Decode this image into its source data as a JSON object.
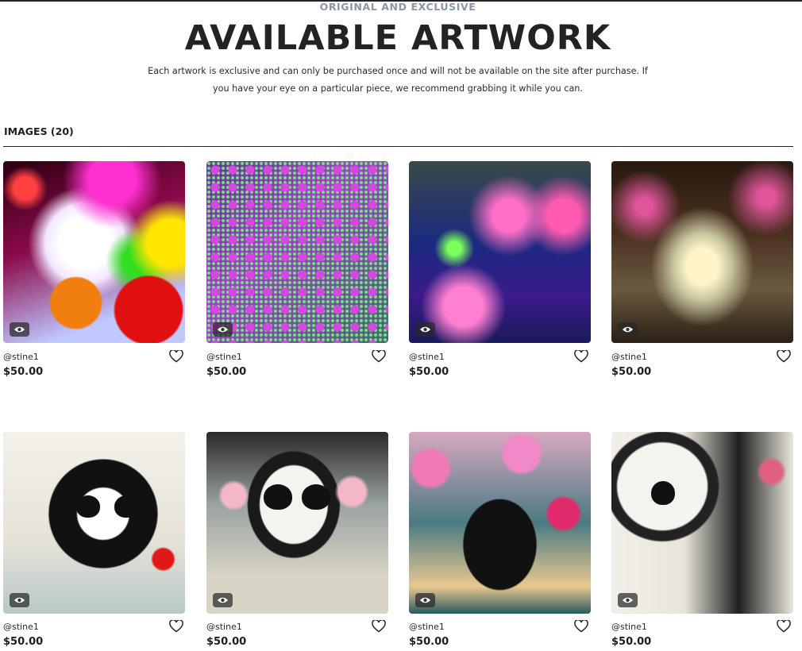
{
  "header": {
    "eyebrow": "ORIGINAL AND EXCLUSIVE",
    "title": "AVAILABLE ARTWORK",
    "description": "Each artwork is exclusive and can only be purchased once and will not be available on the site after purchase. If you have your eye on a particular piece, we recommend grabbing it while you can."
  },
  "gallery": {
    "section_label": "IMAGES (20)",
    "items": [
      {
        "user": "@stine1",
        "price": "$50.00",
        "art": "neon-abstract-light"
      },
      {
        "user": "@stine1",
        "price": "$50.00",
        "art": "purple-dot-pattern"
      },
      {
        "user": "@stine1",
        "price": "$50.00",
        "art": "psychedelic-room"
      },
      {
        "user": "@stine1",
        "price": "$50.00",
        "art": "flower-garden-archway"
      },
      {
        "user": "@stine1",
        "price": "$50.00",
        "art": "skull-with-flowers-1"
      },
      {
        "user": "@stine1",
        "price": "$50.00",
        "art": "skull-with-flowers-2"
      },
      {
        "user": "@stine1",
        "price": "$50.00",
        "art": "skull-with-flowers-3"
      },
      {
        "user": "@stine1",
        "price": "$50.00",
        "art": "skull-with-flowers-4"
      }
    ]
  },
  "icons": {
    "preview": "eye-icon",
    "favorite": "heart-outline-icon"
  }
}
